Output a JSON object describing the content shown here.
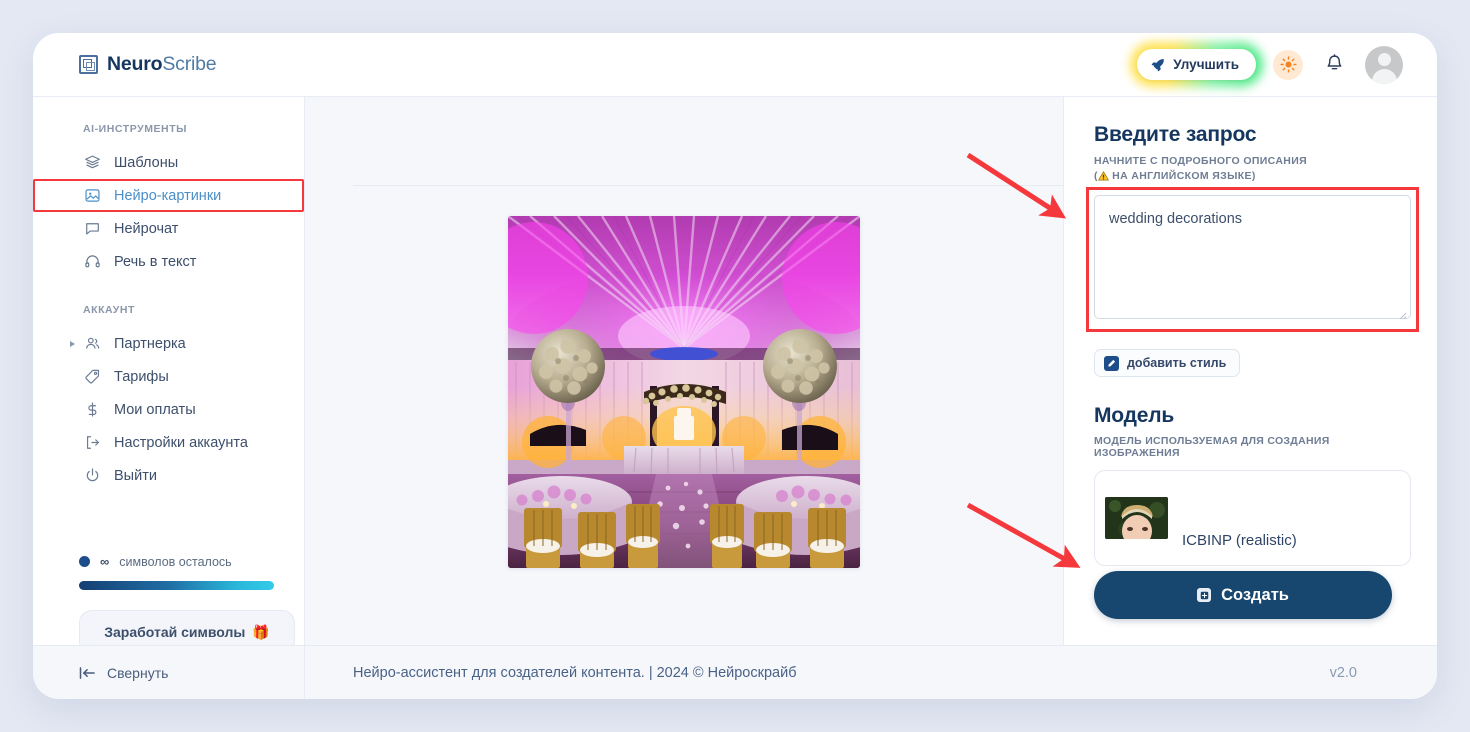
{
  "brand": {
    "name_bold": "Neuro",
    "name_light": "Scribe",
    "logo_icon": "nested-squares-logo-icon"
  },
  "header": {
    "improve_label": "Улучшить",
    "improve_icon": "rocket-icon",
    "theme_icon": "sun-icon",
    "notifications_icon": "bell-icon",
    "avatar_icon": "user-avatar-icon",
    "accent_glow_from": "#ffe14d",
    "accent_glow_to": "#3ee87f"
  },
  "sidebar": {
    "section_tools_title": "AI-ИНСТРУМЕНТЫ",
    "tools": [
      {
        "label": "Шаблоны",
        "icon": "layers-icon",
        "active": false
      },
      {
        "label": "Нейро-картинки",
        "icon": "image-icon",
        "active": true
      },
      {
        "label": "Нейрочат",
        "icon": "chat-bubble-icon",
        "active": false
      },
      {
        "label": "Речь в текст",
        "icon": "headphones-icon",
        "active": false
      }
    ],
    "section_account_title": "АККАУНТ",
    "account": [
      {
        "label": "Партнерка",
        "icon": "users-icon",
        "expandable": true
      },
      {
        "label": "Тарифы",
        "icon": "tag-icon",
        "expandable": false
      },
      {
        "label": "Мои оплаты",
        "icon": "dollar-icon",
        "expandable": false
      },
      {
        "label": "Настройки аккаунта",
        "icon": "logout-arrow-icon",
        "expandable": false
      },
      {
        "label": "Выйти",
        "icon": "power-icon",
        "expandable": false
      }
    ],
    "quota_symbol": "∞",
    "quota_label": "символов осталось",
    "earn_label": "Заработай символы",
    "earn_icon": "gift-emoji-icon",
    "progress_from": "#153f73",
    "progress_to": "#32ccea"
  },
  "main": {
    "image_alt": "wedding-decorations-generated-image"
  },
  "right_panel": {
    "prompt_title": "Введите запрос",
    "prompt_subtitle_line1": "НАЧНИТЕ С ПОДРОБНОГО ОПИСАНИЯ",
    "prompt_subtitle_line2_prefix": "(",
    "prompt_subtitle_line2": "НА АНГЛИЙСКОМ ЯЗЫКЕ)",
    "prompt_warning_icon": "warning-triangle-icon",
    "prompt_value": "wedding decorations",
    "prompt_placeholder": "",
    "style_button_label": "добавить стиль",
    "style_button_icon": "edit-pencil-icon",
    "model_title": "Модель",
    "model_subtitle": "МОДЕЛЬ ИСПОЛЬЗУЕМАЯ ДЛЯ СОЗДАНИЯ ИЗОБРАЖЕНИЯ",
    "model_name": "ICBINP (realistic)",
    "model_thumb_icon": "model-preview-thumbnail",
    "create_label": "Создать",
    "create_icon": "image-plus-icon",
    "create_color": "#17466f",
    "highlight_color": "#f5383b"
  },
  "footer": {
    "collapse_label": "Свернуть",
    "collapse_icon": "collapse-left-icon",
    "tagline": "Нейро-ассистент для создателей контента.  | 2024 © Нейроскрайб",
    "version": "v2.0"
  },
  "annotations": {
    "arrow_color": "#f5383b",
    "arrow_1_target": "prompt-textarea",
    "arrow_2_target": "create-button"
  }
}
